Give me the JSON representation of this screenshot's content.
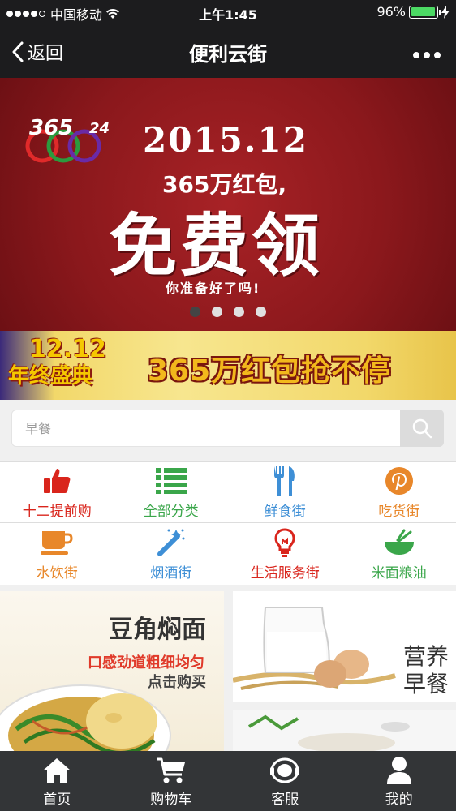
{
  "status_bar": {
    "carrier": "中国移动",
    "time": "上午1:45",
    "battery": "96%",
    "battery_level": 0.96
  },
  "nav": {
    "back_label": "返回",
    "title": "便利云街"
  },
  "banner": {
    "logo_text": "365",
    "logo_suffix": "24",
    "date": "2015.12",
    "subtitle": "365万红包,",
    "headline": "免费领",
    "tagline": "你准备好了吗!",
    "page_count": 4,
    "active_page": 1
  },
  "promo": {
    "date": "12.12",
    "event": "年终盛典",
    "slogan": "365万红包抢不停"
  },
  "search": {
    "placeholder": "早餐"
  },
  "categories": [
    {
      "label": "十二提前购",
      "icon": "thumbs-up-icon",
      "color": "#d9251c"
    },
    {
      "label": "全部分类",
      "icon": "list-icon",
      "color": "#3aa64a"
    },
    {
      "label": "鲜食街",
      "icon": "fork-knife-icon",
      "color": "#3e8fd6"
    },
    {
      "label": "吃货街",
      "icon": "pinterest-icon",
      "color": "#e8872a"
    },
    {
      "label": "水饮街",
      "icon": "coffee-cup-icon",
      "color": "#e8872a"
    },
    {
      "label": "烟酒街",
      "icon": "magic-wand-icon",
      "color": "#3e8fd6"
    },
    {
      "label": "生活服务街",
      "icon": "lightbulb-icon",
      "color": "#d9251c"
    },
    {
      "label": "米面粮油",
      "icon": "bowl-icon",
      "color": "#3aa64a"
    }
  ],
  "products": {
    "noodles": {
      "title": "豆角焖面",
      "desc": "口感劲道粗细均匀",
      "cta": "点击购买"
    },
    "breakfast": {
      "title_line1": "营养",
      "title_line2": "早餐"
    }
  },
  "tabs": [
    {
      "label": "首页",
      "icon": "home-icon"
    },
    {
      "label": "购物车",
      "icon": "cart-icon"
    },
    {
      "label": "客服",
      "icon": "headset-icon"
    },
    {
      "label": "我的",
      "icon": "user-icon"
    }
  ]
}
